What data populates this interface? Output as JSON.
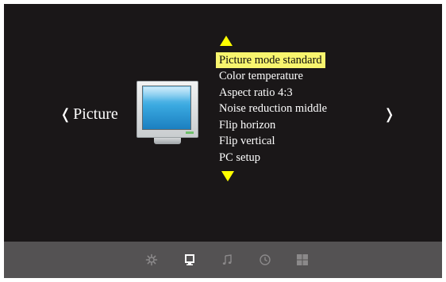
{
  "header": {
    "category_label": "Picture",
    "left_chevron": "❬",
    "right_chevron": "❭"
  },
  "menu": {
    "items": [
      {
        "label": "Picture mode standard",
        "selected": true
      },
      {
        "label": "Color temperature",
        "selected": false
      },
      {
        "label": "Aspect ratio 4:3",
        "selected": false
      },
      {
        "label": "Noise reduction middle",
        "selected": false
      },
      {
        "label": "Flip horizon",
        "selected": false
      },
      {
        "label": "Flip vertical",
        "selected": false
      },
      {
        "label": "PC setup",
        "selected": false
      }
    ]
  },
  "bottom_bar": {
    "icons": [
      {
        "name": "settings-gear-icon",
        "active": false
      },
      {
        "name": "monitor-icon",
        "active": true
      },
      {
        "name": "music-note-icon",
        "active": false
      },
      {
        "name": "clock-icon",
        "active": false
      },
      {
        "name": "grid-icon",
        "active": false
      }
    ]
  },
  "colors": {
    "background": "#1a1718",
    "highlight": "#f8f56e",
    "arrow": "#ffff00",
    "bar": "#545253",
    "icon_inactive": "#8b898a",
    "icon_active": "#ffffff"
  }
}
